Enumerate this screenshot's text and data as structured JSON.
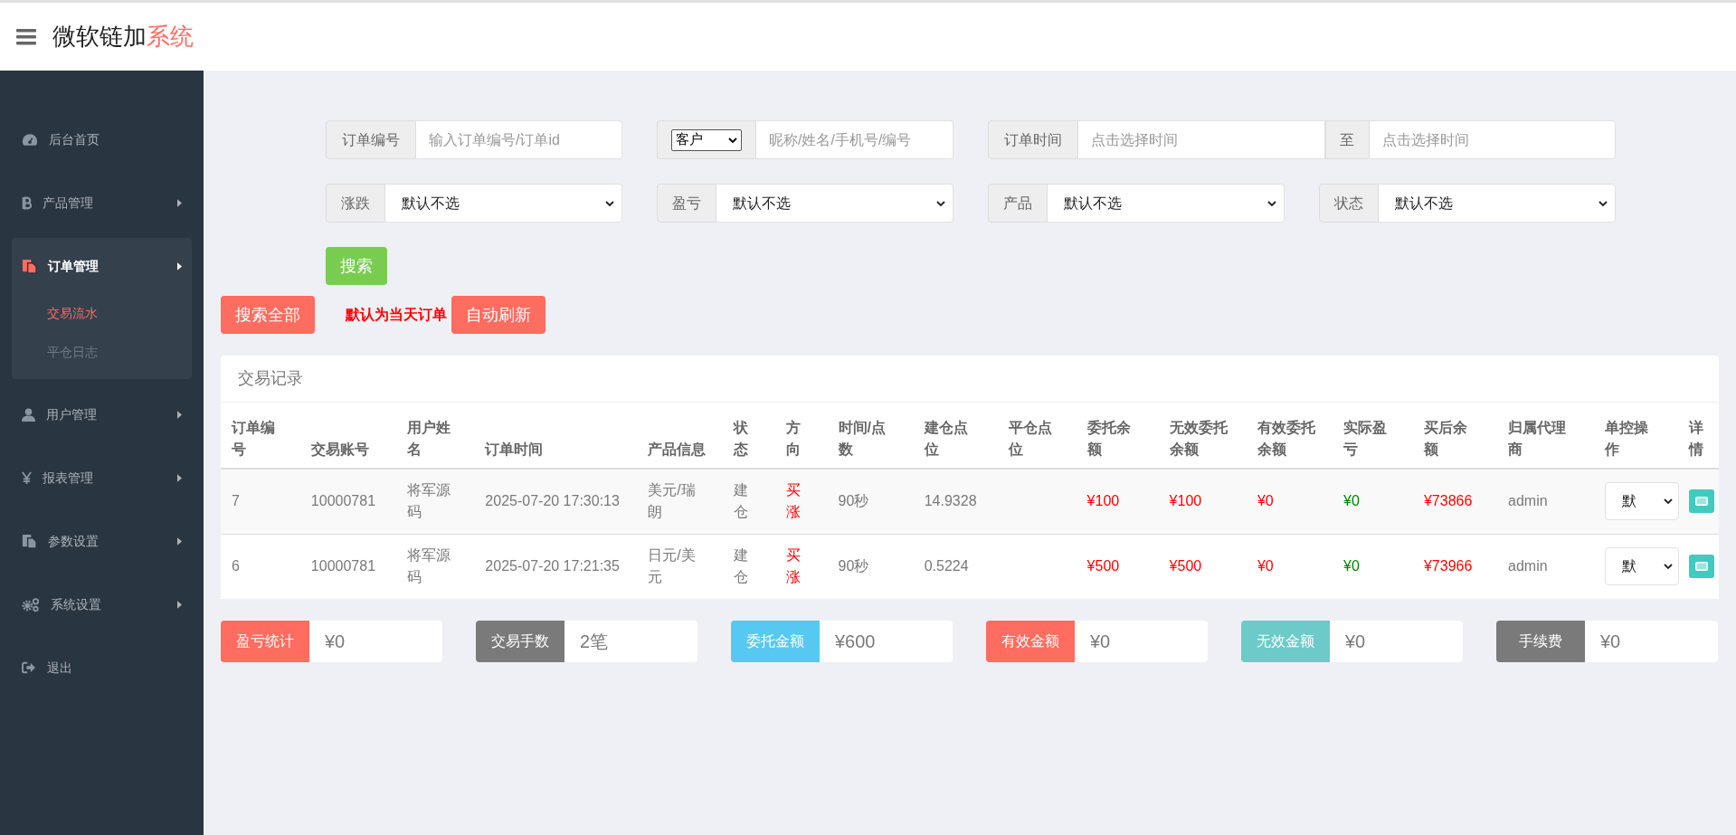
{
  "header": {
    "title_main": "微软链加",
    "title_accent": "系统"
  },
  "sidebar": {
    "items": [
      {
        "label": "后台首页",
        "has_arrow": false,
        "active": false
      },
      {
        "label": "产品管理",
        "has_arrow": true,
        "active": false
      },
      {
        "label": "订单管理",
        "has_arrow": true,
        "active": true,
        "children": [
          {
            "label": "交易流水",
            "selected": true
          },
          {
            "label": "平仓日志",
            "selected": false
          }
        ]
      },
      {
        "label": "用户管理",
        "has_arrow": true,
        "active": false
      },
      {
        "label": "报表管理",
        "has_arrow": true,
        "active": false
      },
      {
        "label": "参数设置",
        "has_arrow": true,
        "active": false
      },
      {
        "label": "系统设置",
        "has_arrow": true,
        "active": false
      },
      {
        "label": "退出",
        "has_arrow": false,
        "active": false
      }
    ]
  },
  "filters": {
    "order_no": {
      "label": "订单编号",
      "placeholder": "输入订单编号/订单id"
    },
    "customer": {
      "select": "客户",
      "placeholder": "昵称/姓名/手机号/编号"
    },
    "order_time": {
      "label": "订单时间",
      "placeholder_from": "点击选择时间",
      "to_label": "至",
      "placeholder_to": "点击选择时间"
    },
    "selects": [
      {
        "label": "涨跌",
        "value": "默认不选"
      },
      {
        "label": "盈亏",
        "value": "默认不选"
      },
      {
        "label": "产品",
        "value": "默认不选"
      },
      {
        "label": "状态",
        "value": "默认不选"
      }
    ],
    "search_button": "搜索"
  },
  "actions": {
    "search_all": "搜索全部",
    "note": "默认为当天订单",
    "auto_refresh": "自动刷新"
  },
  "table": {
    "title": "交易记录",
    "columns": [
      "订单编号",
      "交易账号",
      "用户姓名",
      "订单时间",
      "产品信息",
      "状态",
      "方向",
      "时间/点数",
      "建仓点位",
      "平仓点位",
      "委托余额",
      "无效委托余额",
      "有效委托余额",
      "实际盈亏",
      "买后余额",
      "归属代理商",
      "单控操作",
      "详情"
    ],
    "rows": [
      {
        "cells": [
          {
            "text": "7"
          },
          {
            "text": "10000781"
          },
          {
            "text": "将军源码"
          },
          {
            "text": "2025-07-20 17:30:13"
          },
          {
            "text": "美元/瑞朗"
          },
          {
            "text": "建仓"
          },
          {
            "text": "买涨",
            "color": "#ff0000"
          },
          {
            "text": "90秒"
          },
          {
            "text": "14.9328"
          },
          {},
          {
            "text": "¥100",
            "color": "#ff0000"
          },
          {
            "text": "¥100",
            "color": "#ff0000"
          },
          {
            "text": "¥0",
            "color": "#ff0000"
          },
          {
            "text": "¥0",
            "color": "#008000"
          },
          {
            "text": "¥73866",
            "color": "#ff0000"
          },
          {
            "text": "admin"
          }
        ],
        "control": "默"
      },
      {
        "cells": [
          {
            "text": "6"
          },
          {
            "text": "10000781"
          },
          {
            "text": "将军源码"
          },
          {
            "text": "2025-07-20 17:21:35"
          },
          {
            "text": "日元/美元"
          },
          {
            "text": "建仓"
          },
          {
            "text": "买涨",
            "color": "#ff0000"
          },
          {
            "text": "90秒"
          },
          {
            "text": "0.5224"
          },
          {},
          {
            "text": "¥500",
            "color": "#ff0000"
          },
          {
            "text": "¥500",
            "color": "#ff0000"
          },
          {
            "text": "¥0",
            "color": "#ff0000"
          },
          {
            "text": "¥0",
            "color": "#008000"
          },
          {
            "text": "¥73966",
            "color": "#ff0000"
          },
          {
            "text": "admin"
          }
        ],
        "control": "默"
      }
    ]
  },
  "stats": [
    {
      "label": "盈亏统计",
      "value": "¥0",
      "color": "#ff6c60"
    },
    {
      "label": "交易手数",
      "value": "2笔",
      "color": "#7a7a7a"
    },
    {
      "label": "委托金额",
      "value": "¥600",
      "color": "#57c8f2"
    },
    {
      "label": "有效金额",
      "value": "¥0",
      "color": "#ff6c60"
    },
    {
      "label": "无效金额",
      "value": "¥0",
      "color": "#6ccac9"
    },
    {
      "label": "手续费",
      "value": "¥0",
      "color": "#7a7a7a"
    }
  ]
}
